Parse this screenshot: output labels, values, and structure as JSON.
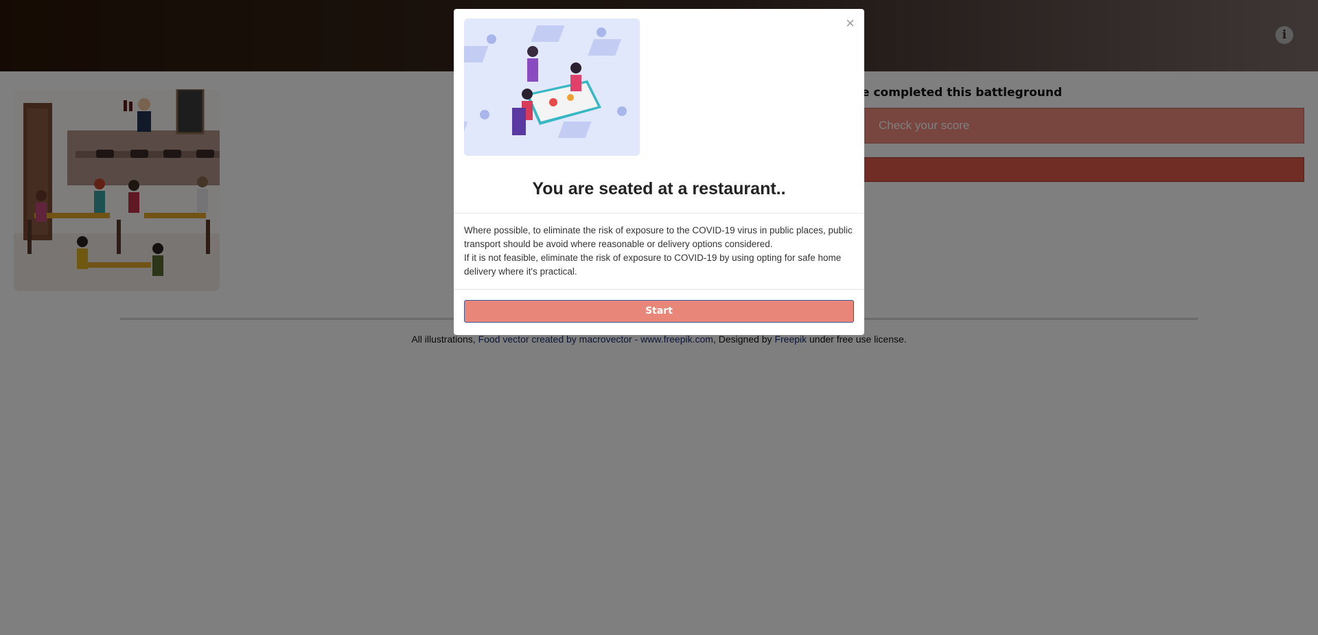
{
  "header": {
    "info_icon": "info-circle-icon",
    "info_glyph": "i"
  },
  "main": {
    "completed_text": "e completed this battleground",
    "score_button_label": "Check your score"
  },
  "footer": {
    "credit_prefix": "All illustrations, ",
    "credit_link1": "Food vector created by macrovector - www.freepik.com",
    "credit_sep": ", Designed by ",
    "credit_link2": "Freepik",
    "credit_suffix": " under free use license."
  },
  "modal": {
    "close_glyph": "×",
    "title": "You are seated at a restaurant..",
    "body_line1": "Where possible, to eliminate the risk of exposure to the COVID-19 virus in public places, public transport should be avoid where reasonable or delivery options considered.",
    "body_line2": "If it is not feasible, eliminate the risk of exposure to COVID-19 by using opting for safe home delivery where it's practical.",
    "start_label": "Start"
  },
  "colors": {
    "accent": "#f08b7f",
    "start_button": "#e8867a",
    "header_dark": "#2a1708"
  }
}
